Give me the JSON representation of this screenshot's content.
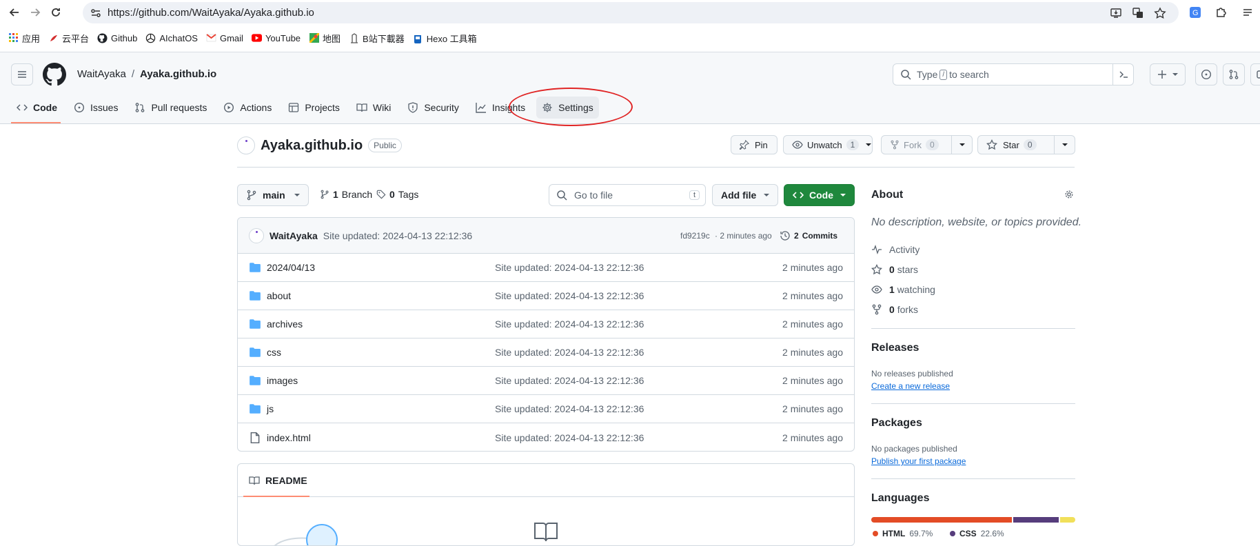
{
  "browser": {
    "url": "https://github.com/WaitAyaka/Ayaka.github.io",
    "bookmarks": [
      {
        "label": "应用",
        "icon": "apps-grid-icon"
      },
      {
        "label": "云平台",
        "icon": "cloud-platform-icon"
      },
      {
        "label": "Github",
        "icon": "github-icon"
      },
      {
        "label": "AIchatOS",
        "icon": "openai-icon"
      },
      {
        "label": "Gmail",
        "icon": "gmail-icon"
      },
      {
        "label": "YouTube",
        "icon": "youtube-icon"
      },
      {
        "label": "地图",
        "icon": "maps-icon"
      },
      {
        "label": "B站下載器",
        "icon": "bilibili-icon"
      },
      {
        "label": "Hexo 工具箱",
        "icon": "hexo-icon"
      }
    ]
  },
  "header": {
    "owner": "WaitAyaka",
    "separator": "/",
    "repo": "Ayaka.github.io",
    "search_text_before": "Type",
    "search_kbd": "/",
    "search_text_after": "to search"
  },
  "tabs": [
    {
      "label": "Code",
      "icon": "code-icon",
      "active": true
    },
    {
      "label": "Issues",
      "icon": "issue-icon"
    },
    {
      "label": "Pull requests",
      "icon": "pull-request-icon"
    },
    {
      "label": "Actions",
      "icon": "play-icon"
    },
    {
      "label": "Projects",
      "icon": "table-icon"
    },
    {
      "label": "Wiki",
      "icon": "book-icon"
    },
    {
      "label": "Security",
      "icon": "shield-icon"
    },
    {
      "label": "Insights",
      "icon": "graph-icon"
    },
    {
      "label": "Settings",
      "icon": "gear-icon"
    }
  ],
  "repo": {
    "name": "Ayaka.github.io",
    "visibility": "Public",
    "pin_label": "Pin",
    "unwatch_label": "Unwatch",
    "watch_count": "1",
    "fork_label": "Fork",
    "fork_count": "0",
    "star_label": "Star",
    "star_count": "0"
  },
  "controls": {
    "branch": "main",
    "branch_count": "1",
    "branch_label": "Branch",
    "tag_count": "0",
    "tag_label": "Tags",
    "goto_placeholder": "Go to file",
    "goto_kbd": "t",
    "add_file_label": "Add file",
    "code_label": "Code"
  },
  "commit": {
    "author": "WaitAyaka",
    "message": "Site updated: 2024-04-13 22:12:36",
    "sha": "fd9219c",
    "time": "· 2 minutes ago",
    "commits_count": "2",
    "commits_label": "Commits"
  },
  "files": [
    {
      "name": "2024/04/13",
      "type": "folder",
      "message": "Site updated: 2024-04-13 22:12:36",
      "time": "2 minutes ago"
    },
    {
      "name": "about",
      "type": "folder",
      "message": "Site updated: 2024-04-13 22:12:36",
      "time": "2 minutes ago"
    },
    {
      "name": "archives",
      "type": "folder",
      "message": "Site updated: 2024-04-13 22:12:36",
      "time": "2 minutes ago"
    },
    {
      "name": "css",
      "type": "folder",
      "message": "Site updated: 2024-04-13 22:12:36",
      "time": "2 minutes ago"
    },
    {
      "name": "images",
      "type": "folder",
      "message": "Site updated: 2024-04-13 22:12:36",
      "time": "2 minutes ago"
    },
    {
      "name": "js",
      "type": "folder",
      "message": "Site updated: 2024-04-13 22:12:36",
      "time": "2 minutes ago"
    },
    {
      "name": "index.html",
      "type": "file",
      "message": "Site updated: 2024-04-13 22:12:36",
      "time": "2 minutes ago"
    }
  ],
  "readme": {
    "label": "README"
  },
  "about": {
    "title": "About",
    "description": "No description, website, or topics provided.",
    "activity_label": "Activity",
    "stars_count": "0",
    "stars_label": "stars",
    "watching_count": "1",
    "watching_label": "watching",
    "forks_count": "0",
    "forks_label": "forks"
  },
  "releases": {
    "title": "Releases",
    "empty": "No releases published",
    "link": "Create a new release"
  },
  "packages": {
    "title": "Packages",
    "empty": "No packages published",
    "link": "Publish your first package"
  },
  "languages": {
    "title": "Languages",
    "items": [
      {
        "name": "HTML",
        "percent": "69.7%",
        "value": 69.7,
        "color": "#e34c26"
      },
      {
        "name": "CSS",
        "percent": "22.6%",
        "value": 22.6,
        "color": "#563d7c"
      },
      {
        "name": "",
        "percent": "",
        "value": 7.7,
        "color": "#f1e05a"
      }
    ]
  }
}
